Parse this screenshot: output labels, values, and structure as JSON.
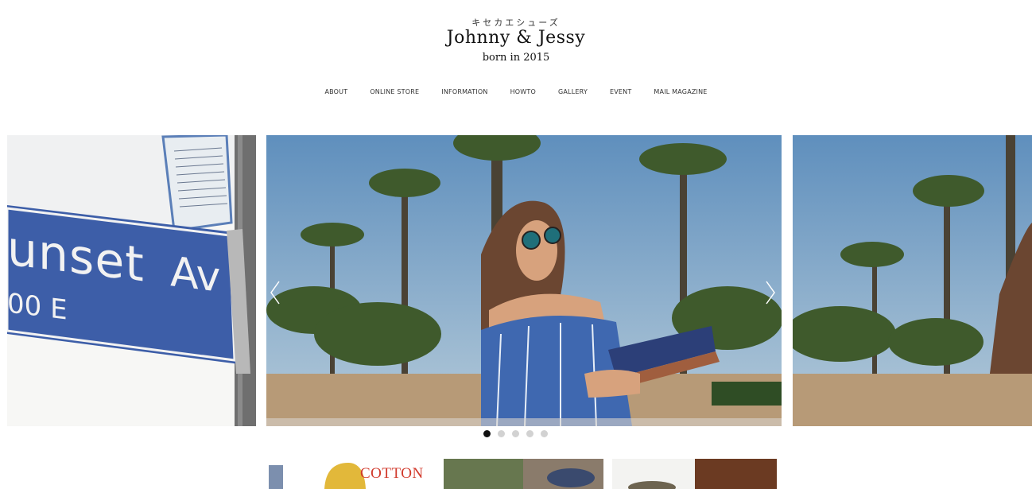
{
  "header": {
    "kana": "キセカエシューズ",
    "brand": "Johnny & Jessy",
    "tagline": "born in 2015"
  },
  "nav": {
    "items": [
      {
        "label": "ABOUT"
      },
      {
        "label": "ONLINE STORE"
      },
      {
        "label": "INFORMATION"
      },
      {
        "label": "HOWTO"
      },
      {
        "label": "GALLERY"
      },
      {
        "label": "EVENT"
      },
      {
        "label": "MAIL MAGAZINE"
      }
    ]
  },
  "slider": {
    "left_sign_text": "unset",
    "left_sign_text2": "Av",
    "left_sign_text3": "00 E",
    "active_index": 0,
    "dot_count": 5,
    "prev_icon": "chevron-left-icon",
    "next_icon": "chevron-right-icon"
  },
  "thumbnails": {
    "first_caption": "COTTON"
  },
  "colors": {
    "accent_red": "#d13a2c",
    "dot_active": "#111111",
    "dot_inactive": "#d2d2d2",
    "sign_blue": "#3d5ea8",
    "sky": "#7fa6c9"
  }
}
